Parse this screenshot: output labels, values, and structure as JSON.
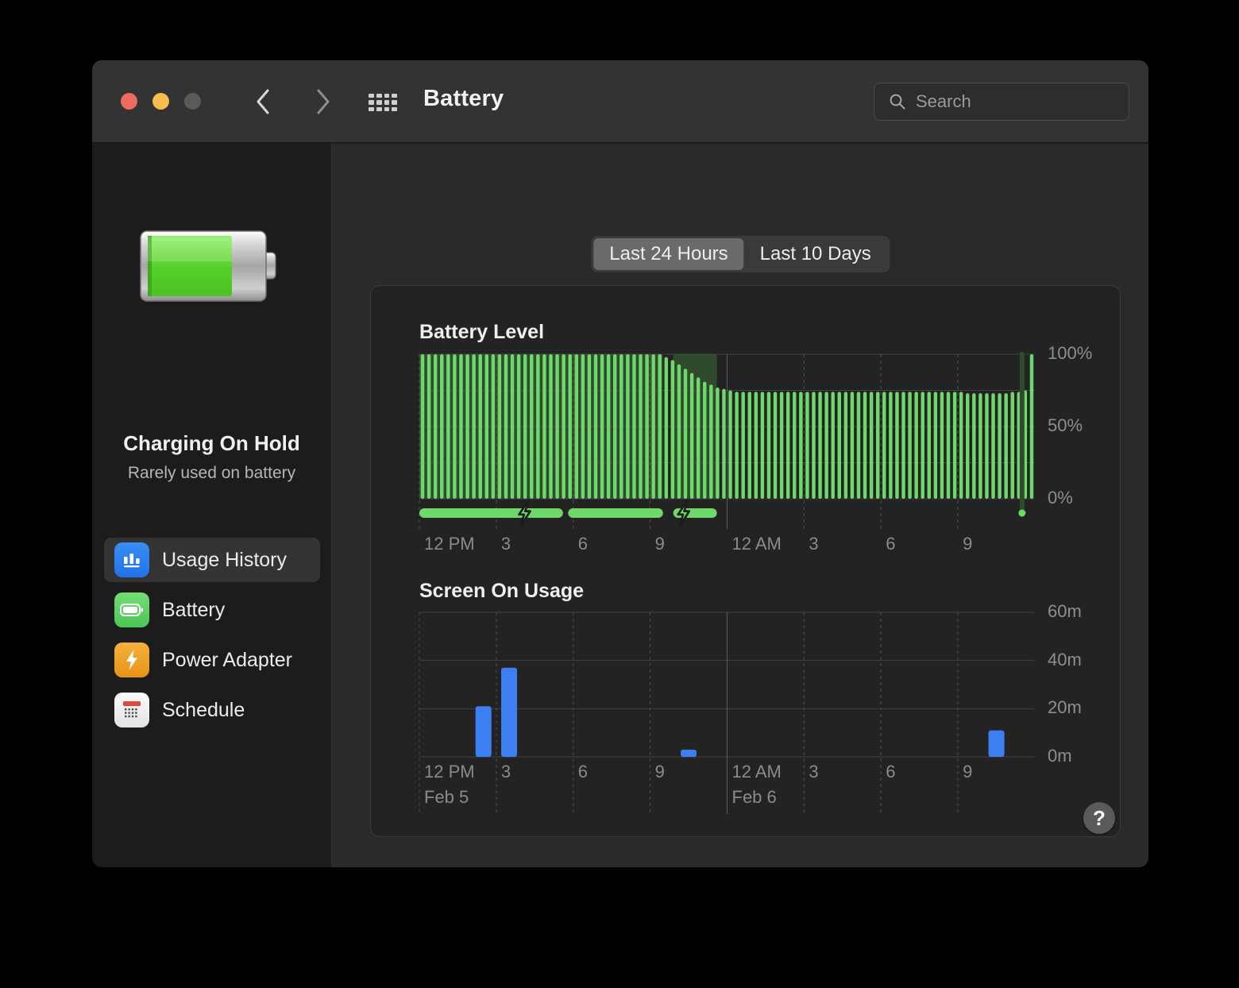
{
  "window": {
    "title": "Battery",
    "traffic_lights": [
      "close",
      "minimize",
      "maximize"
    ],
    "back_label": "Back",
    "forward_label": "Forward",
    "grid_label": "Show All"
  },
  "search": {
    "placeholder": "Search"
  },
  "sidebar": {
    "status_title": "Charging On Hold",
    "status_subtitle": "Rarely used on battery",
    "items": [
      {
        "label": "Usage History",
        "icon": "bar-chart-icon",
        "selected": true
      },
      {
        "label": "Battery",
        "icon": "battery-icon",
        "selected": false
      },
      {
        "label": "Power Adapter",
        "icon": "bolt-icon",
        "selected": false
      },
      {
        "label": "Schedule",
        "icon": "calendar-icon",
        "selected": false
      }
    ]
  },
  "segmented_control": {
    "options": [
      "Last 24 Hours",
      "Last 10 Days"
    ],
    "selected": "Last 24 Hours"
  },
  "help_button": {
    "label": "?"
  },
  "colors": {
    "battery_bar": "#6ed86b",
    "charging_region": "#2f4a2c",
    "screen_bar": "#3d7ff0",
    "accent_blue": "#2f7ff0",
    "window_bg": "#1e1e1e",
    "titlebar_bg": "#333333",
    "sidebar_bg": "#1c1c1c",
    "content_bg": "#2a2a2a",
    "card_bg": "#232323"
  },
  "chart_data": [
    {
      "type": "bar",
      "title": "Battery Level",
      "xlabel": "",
      "ylabel": "",
      "ylim": [
        0,
        100
      ],
      "ytick_labels": [
        "100%",
        "50%",
        "0%"
      ],
      "ytick_values": [
        100,
        50,
        0
      ],
      "gridlines_y": [
        100,
        75,
        50,
        25,
        0
      ],
      "grid": true,
      "xtick_labels": [
        "12 PM",
        "3",
        "6",
        "9",
        "12 AM",
        "3",
        "6",
        "9"
      ],
      "xtick_hours": [
        0,
        3,
        6,
        9,
        12,
        15,
        18,
        21
      ],
      "x_start_hour": 0,
      "x_end_hour": 24,
      "bar_unit_minutes": 15,
      "values": [
        100,
        100,
        100,
        100,
        100,
        100,
        100,
        100,
        100,
        100,
        100,
        100,
        100,
        100,
        100,
        100,
        100,
        100,
        100,
        100,
        100,
        100,
        100,
        100,
        100,
        100,
        100,
        100,
        100,
        100,
        100,
        100,
        100,
        100,
        100,
        100,
        100,
        100,
        98,
        96,
        93,
        90,
        87,
        84,
        81,
        79,
        77,
        76,
        75,
        74,
        74,
        74,
        74,
        74,
        74,
        74,
        74,
        74,
        74,
        74,
        74,
        74,
        74,
        74,
        74,
        74,
        74,
        74,
        74,
        74,
        74,
        74,
        74,
        74,
        74,
        74,
        74,
        74,
        74,
        74,
        74,
        74,
        74,
        74,
        74,
        73,
        73,
        73,
        73,
        73,
        73,
        73,
        74,
        74,
        75,
        100
      ],
      "charging_regions": [
        {
          "start_hour": 0.0,
          "end_hour": 9.5
        },
        {
          "start_hour": 9.9,
          "end_hour": 11.6
        }
      ],
      "charging_bar_segments": [
        {
          "start_hour": 0.0,
          "end_hour": 5.6
        },
        {
          "start_hour": 5.8,
          "end_hour": 9.5
        },
        {
          "start_hour": 9.9,
          "end_hour": 11.6
        }
      ],
      "bolt_markers_hour": [
        4.1,
        10.3
      ],
      "now_marker_hour": 23.5,
      "annotations": [
        "charging periods shaded dark green",
        "lightning bolts mark charging"
      ]
    },
    {
      "type": "bar",
      "title": "Screen On Usage",
      "xlabel": "",
      "ylabel": "",
      "ylim": [
        0,
        60
      ],
      "ytick_labels": [
        "60m",
        "40m",
        "20m",
        "0m"
      ],
      "ytick_values": [
        60,
        40,
        20,
        0
      ],
      "gridlines_y": [
        60,
        40,
        20,
        0
      ],
      "grid": true,
      "xtick_labels": [
        "12 PM",
        "3",
        "6",
        "9",
        "12 AM",
        "3",
        "6",
        "9"
      ],
      "xtick_hours": [
        0,
        3,
        6,
        9,
        12,
        15,
        18,
        21
      ],
      "date_labels": [
        {
          "hour": 0,
          "text": "Feb 5"
        },
        {
          "hour": 12,
          "text": "Feb 6"
        }
      ],
      "x_start_hour": 0,
      "x_end_hour": 24,
      "bar_unit_minutes": 60,
      "categories": [
        "12 PM",
        "1 PM",
        "2 PM",
        "3 PM",
        "4 PM",
        "5 PM",
        "6 PM",
        "7 PM",
        "8 PM",
        "9 PM",
        "10 PM",
        "11 PM",
        "12 AM",
        "1 AM",
        "2 AM",
        "3 AM",
        "4 AM",
        "5 AM",
        "6 AM",
        "7 AM",
        "8 AM",
        "9 AM",
        "10 AM",
        "11 AM"
      ],
      "values": [
        0,
        0,
        21,
        37,
        0,
        0,
        0,
        0,
        0,
        0,
        3,
        0,
        0,
        0,
        0,
        0,
        0,
        0,
        0,
        0,
        0,
        0,
        11,
        0
      ]
    }
  ]
}
